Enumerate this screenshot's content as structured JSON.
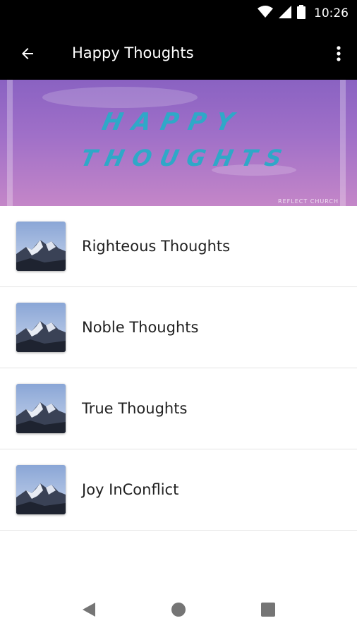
{
  "status_bar": {
    "time": "10:26",
    "icons": [
      "wifi-icon",
      "signal-icon",
      "battery-icon"
    ]
  },
  "app_bar": {
    "title": "Happy Thoughts",
    "back_icon": "arrow-left-icon",
    "menu_icon": "more-vert-icon"
  },
  "banner": {
    "line1": "HAPPY",
    "line2": "THOUGHTS",
    "logo_text": "REFLECT CHURCH"
  },
  "list": {
    "items": [
      {
        "label": "Righteous Thoughts",
        "thumb_icon": "mountain-thumbnail"
      },
      {
        "label": "Noble Thoughts",
        "thumb_icon": "mountain-thumbnail"
      },
      {
        "label": "True Thoughts",
        "thumb_icon": "mountain-thumbnail"
      },
      {
        "label": "Joy InConflict",
        "thumb_icon": "mountain-thumbnail"
      }
    ]
  },
  "nav_bar": {
    "icons": [
      "back-triangle-icon",
      "home-circle-icon",
      "recents-square-icon"
    ]
  },
  "colors": {
    "app_bar_bg": "#000000",
    "banner_text": "#2fa8c8",
    "banner_purple": "#a070c8"
  }
}
